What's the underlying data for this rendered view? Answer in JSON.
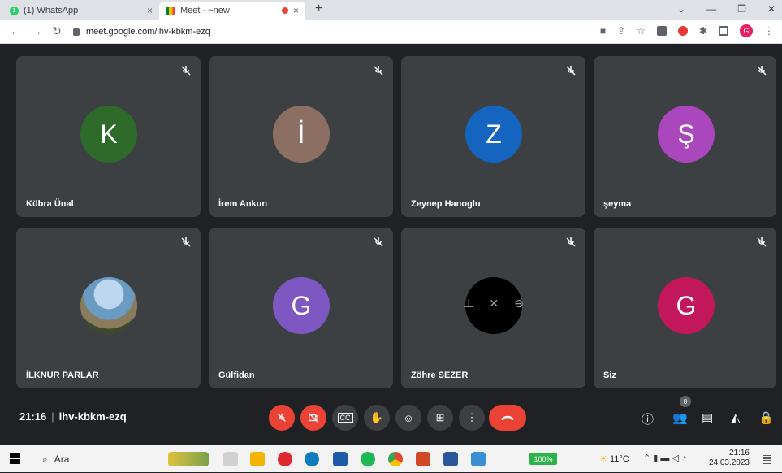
{
  "browser": {
    "tabs": [
      {
        "title": "(1) WhatsApp",
        "close": "×"
      },
      {
        "title": "Meet - ~new",
        "close": "×"
      }
    ],
    "new_tab": "+",
    "url": "meet.google.com/ihv-kbkm-ezq",
    "profile_initial": "G"
  },
  "meeting": {
    "time": "21:16",
    "separator": "|",
    "code": "ihv-kbkm-ezq",
    "participants_count": "8"
  },
  "participants": [
    {
      "name": "Kübra Ünal",
      "initial": "K",
      "color": "#2e6b2b"
    },
    {
      "name": "İrem Ankun",
      "initial": "İ",
      "color": "#8d6e63"
    },
    {
      "name": "Zeynep Hanoglu",
      "initial": "Z",
      "color": "#1565c0"
    },
    {
      "name": "şeyma",
      "initial": "Ş",
      "color": "#ab47bc"
    },
    {
      "name": "İLKNUR PARLAR",
      "initial": "",
      "color": "#6a9bc2"
    },
    {
      "name": "Gülfidan",
      "initial": "G",
      "color": "#7e57c2"
    },
    {
      "name": "Zöhre SEZER",
      "initial": "",
      "color": "#000000"
    },
    {
      "name": "Siz",
      "initial": "G",
      "color": "#c2185b"
    }
  ],
  "taskbar": {
    "search_label": "Ara",
    "battery": "100%",
    "temperature": "11°C",
    "clock_time": "21:16",
    "clock_date": "24.03.2023"
  }
}
